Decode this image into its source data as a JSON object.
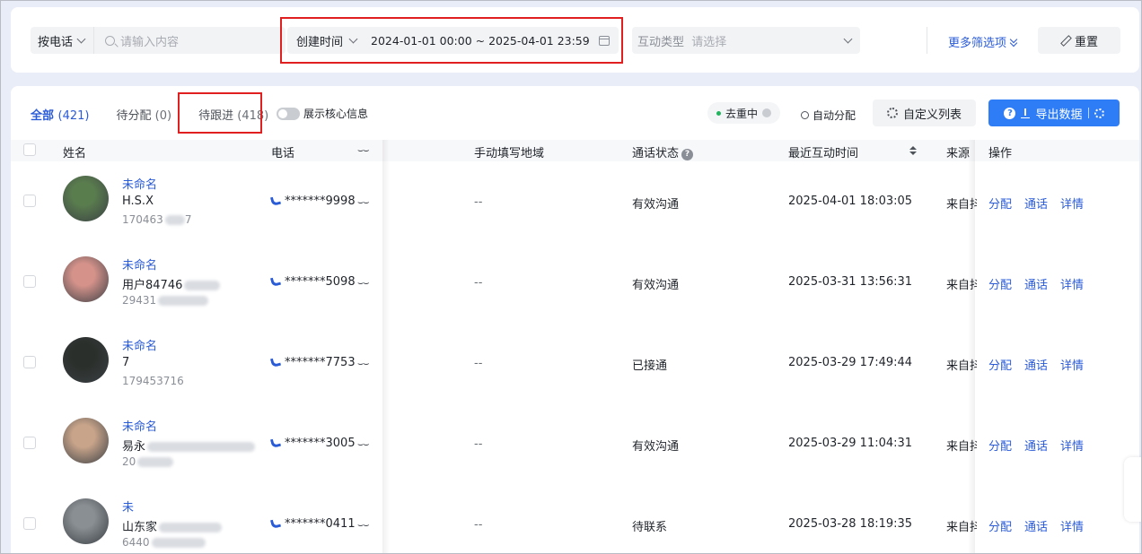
{
  "filters": {
    "search_type": "按电话",
    "search_placeholder": "请输入内容",
    "date_field": "创建时间",
    "date_range": "2024-01-01 00:00 ~ 2025-04-01 23:59",
    "interaction_type_label": "互动类型",
    "interaction_type_placeholder": "请选择",
    "more_filters": "更多筛选项",
    "reset": "重置"
  },
  "tabs": [
    {
      "label": "全部",
      "count": "(421)"
    },
    {
      "label": "待分配",
      "count": "(0)"
    },
    {
      "label": "待跟进",
      "count": "(418)"
    }
  ],
  "toolbar": {
    "core_info_toggle": "展示核心信息",
    "dedupe": "去重中",
    "auto_assign": "自动分配",
    "custom_list": "自定义列表",
    "export": "导出数据"
  },
  "columns": {
    "name": "姓名",
    "phone": "电话",
    "partial": "",
    "region": "手动填写地域",
    "call_status": "通话状态",
    "last_interaction": "最近互动时间",
    "source": "来源",
    "actions": "操作"
  },
  "rows": [
    {
      "name": "未命名",
      "sub": "H.S.X",
      "id": "170463",
      "id_tail": "7",
      "phone": "*******9998",
      "region": "--",
      "status": "有效沟通",
      "time": "2025-04-01 18:03:05",
      "source": "来自抖",
      "avatar_color": "#5a7d4e"
    },
    {
      "name": "未命名",
      "sub": "用户84746",
      "id": "29431",
      "id_tail": "",
      "phone": "*******5098",
      "region": "--",
      "status": "有效沟通",
      "time": "2025-03-31 13:56:31",
      "source": "来自抖",
      "avatar_color": "#d4928a"
    },
    {
      "name": "未命名",
      "sub": "7",
      "id": "179453716",
      "id_tail": "",
      "phone": "*******7753",
      "region": "--",
      "status": "已接通",
      "time": "2025-03-29 17:49:44",
      "source": "来自抖",
      "avatar_color": "#2b2f2b"
    },
    {
      "name": "未命名",
      "sub": "易永",
      "id": "20",
      "id_tail": "",
      "phone": "*******3005",
      "region": "--",
      "status": "有效沟通",
      "time": "2025-03-29 11:04:31",
      "source": "来自抖",
      "avatar_color": "#c8a48a"
    },
    {
      "name": "未",
      "sub": "山东家",
      "id": "6440",
      "id_tail": "",
      "phone": "*******0411",
      "region": "--",
      "status": "待联系",
      "time": "2025-03-28 18:19:35",
      "source": "来自抖",
      "avatar_color": "#8a8f94"
    }
  ],
  "actions": {
    "assign": "分配",
    "call": "通话",
    "detail": "详情"
  }
}
